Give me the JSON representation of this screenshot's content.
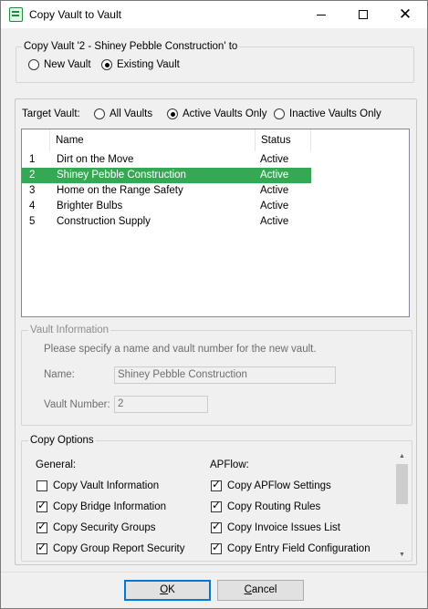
{
  "window": {
    "title": "Copy Vault to Vault"
  },
  "copy_group": {
    "label": "Copy Vault '2 - Shiney Pebble Construction' to",
    "new_vault": "New Vault",
    "existing_vault": "Existing Vault",
    "selected": "existing_vault"
  },
  "target": {
    "label": "Target Vault:",
    "all": "All Vaults",
    "active": "Active Vaults Only",
    "inactive": "Inactive Vaults Only",
    "selected": "active"
  },
  "vault_list": {
    "columns": {
      "num": "",
      "name": "Name",
      "status": "Status"
    },
    "rows": [
      {
        "num": "1",
        "name": "Dirt on the Move",
        "status": "Active"
      },
      {
        "num": "2",
        "name": "Shiney Pebble Construction",
        "status": "Active",
        "selected": true
      },
      {
        "num": "3",
        "name": "Home on the Range Safety",
        "status": "Active"
      },
      {
        "num": "4",
        "name": "Brighter Bulbs",
        "status": "Active"
      },
      {
        "num": "5",
        "name": "Construction Supply",
        "status": "Active"
      }
    ],
    "selection_color": "#35a853"
  },
  "vault_info": {
    "label": "Vault Information",
    "hint": "Please specify a name and vault number for the new vault.",
    "name_label": "Name:",
    "name_value": "Shiney Pebble Construction",
    "number_label": "Vault Number:",
    "number_value": "2"
  },
  "copy_options": {
    "label": "Copy Options",
    "general": {
      "heading": "General:",
      "items": [
        {
          "label": "Copy Vault Information",
          "checked": false
        },
        {
          "label": "Copy Bridge Information",
          "checked": true
        },
        {
          "label": "Copy Security Groups",
          "checked": true
        },
        {
          "label": "Copy Group Report Security",
          "checked": true
        }
      ]
    },
    "apflow": {
      "heading": "APFlow:",
      "items": [
        {
          "label": "Copy APFlow Settings",
          "checked": true
        },
        {
          "label": "Copy Routing Rules",
          "checked": true
        },
        {
          "label": "Copy Invoice Issues List",
          "checked": true
        },
        {
          "label": "Copy Entry Field Configuration",
          "checked": true
        }
      ]
    }
  },
  "buttons": {
    "ok": {
      "accel": "O",
      "rest": "K"
    },
    "cancel": {
      "accel": "C",
      "rest": "ancel"
    }
  }
}
